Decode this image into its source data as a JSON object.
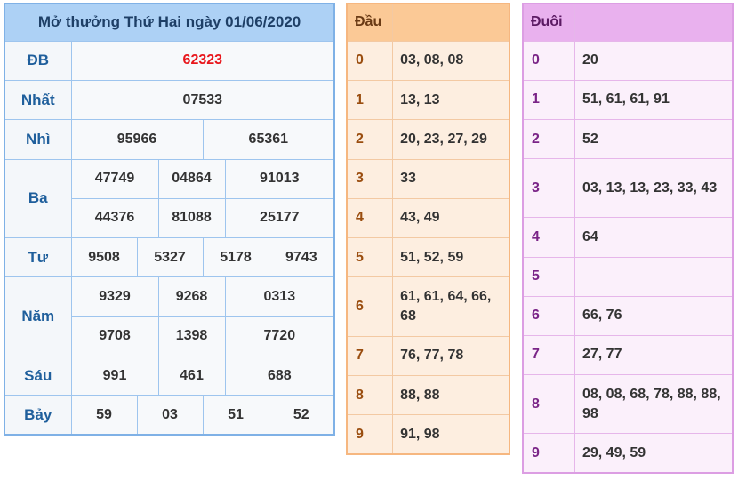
{
  "results": {
    "title": "Mở thưởng Thứ Hai ngày 01/06/2020",
    "db": {
      "label": "ĐB",
      "values": [
        "62323"
      ]
    },
    "nhat": {
      "label": "Nhất",
      "values": [
        "07533"
      ]
    },
    "nhi": {
      "label": "Nhì",
      "values": [
        "95966",
        "65361"
      ]
    },
    "ba": {
      "label": "Ba",
      "values": [
        "47749",
        "04864",
        "91013",
        "44376",
        "81088",
        "25177"
      ]
    },
    "tu": {
      "label": "Tư",
      "values": [
        "9508",
        "5327",
        "5178",
        "9743"
      ]
    },
    "nam": {
      "label": "Năm",
      "values": [
        "9329",
        "9268",
        "0313",
        "9708",
        "1398",
        "7720"
      ]
    },
    "sau": {
      "label": "Sáu",
      "values": [
        "991",
        "461",
        "688"
      ]
    },
    "bay": {
      "label": "Bảy",
      "values": [
        "59",
        "03",
        "51",
        "52"
      ]
    }
  },
  "head_table": {
    "title": "Đầu",
    "rows": [
      {
        "key": "0",
        "value": "03, 08, 08"
      },
      {
        "key": "1",
        "value": "13, 13"
      },
      {
        "key": "2",
        "value": "20, 23, 27, 29"
      },
      {
        "key": "3",
        "value": "33"
      },
      {
        "key": "4",
        "value": "43, 49"
      },
      {
        "key": "5",
        "value": "51, 52, 59"
      },
      {
        "key": "6",
        "value": "61, 61, 64, 66, 68"
      },
      {
        "key": "7",
        "value": "76, 77, 78"
      },
      {
        "key": "8",
        "value": "88, 88"
      },
      {
        "key": "9",
        "value": "91, 98"
      }
    ]
  },
  "tail_table": {
    "title": "Đuôi",
    "rows": [
      {
        "key": "0",
        "value": "20"
      },
      {
        "key": "1",
        "value": "51, 61, 61, 91"
      },
      {
        "key": "2",
        "value": "52"
      },
      {
        "key": "3",
        "value": "03, 13, 13, 23, 33, 43"
      },
      {
        "key": "4",
        "value": "64"
      },
      {
        "key": "5",
        "value": ""
      },
      {
        "key": "6",
        "value": "66, 76"
      },
      {
        "key": "7",
        "value": "27, 77"
      },
      {
        "key": "8",
        "value": "08, 08, 68, 78, 88, 88, 98"
      },
      {
        "key": "9",
        "value": "29, 49, 59"
      }
    ]
  },
  "colors": {
    "results_header": "#add1f5",
    "special_prize": "#e8161b",
    "head_header": "#fbc996",
    "tail_header": "#e9b1ee"
  }
}
